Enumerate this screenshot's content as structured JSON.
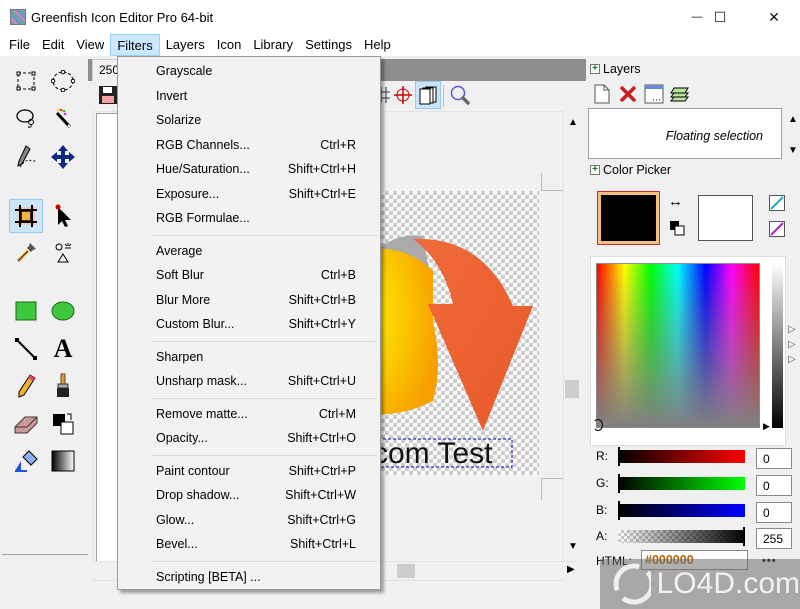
{
  "window": {
    "title": "Greenfish Icon Editor Pro 64-bit",
    "minimize_glyph": "—",
    "maximize_glyph": "☐",
    "close_glyph": "✕"
  },
  "menubar": {
    "items": [
      {
        "label": "File"
      },
      {
        "label": "Edit"
      },
      {
        "label": "View"
      },
      {
        "label": "Filters",
        "active": true
      },
      {
        "label": "Layers"
      },
      {
        "label": "Icon"
      },
      {
        "label": "Library"
      },
      {
        "label": "Settings"
      },
      {
        "label": "Help"
      }
    ]
  },
  "toolbox": {
    "tools": [
      {
        "name": "rect-select-icon"
      },
      {
        "name": "ellipse-select-icon"
      },
      {
        "name": "lasso-icon"
      },
      {
        "name": "magic-wand-icon"
      },
      {
        "name": "freehand-select-icon"
      },
      {
        "name": "move-icon"
      },
      {
        "name": "crop-icon",
        "selected": true
      },
      {
        "name": "pointer-icon"
      },
      {
        "name": "eyedropper-icon"
      },
      {
        "name": "fill-icon"
      },
      {
        "name": "rectangle-icon"
      },
      {
        "name": "ellipse-icon"
      },
      {
        "name": "line-icon"
      },
      {
        "name": "text-icon",
        "glyph": "A"
      },
      {
        "name": "pencil-icon"
      },
      {
        "name": "brush-icon"
      },
      {
        "name": "eraser-icon"
      },
      {
        "name": "color-replace-icon"
      },
      {
        "name": "gradient-fill-icon"
      },
      {
        "name": "gradient-icon"
      }
    ]
  },
  "document": {
    "tab_label": "250",
    "canvas_text": "com Test"
  },
  "filters_menu": {
    "groups": [
      [
        {
          "label": "Grayscale",
          "shortcut": ""
        },
        {
          "label": "Invert",
          "shortcut": ""
        },
        {
          "label": "Solarize",
          "shortcut": ""
        },
        {
          "label": "RGB Channels...",
          "shortcut": "Ctrl+R"
        },
        {
          "label": "Hue/Saturation...",
          "shortcut": "Shift+Ctrl+H"
        },
        {
          "label": "Exposure...",
          "shortcut": "Shift+Ctrl+E"
        },
        {
          "label": "RGB Formulae...",
          "shortcut": ""
        }
      ],
      [
        {
          "label": "Average",
          "shortcut": ""
        },
        {
          "label": "Soft Blur",
          "shortcut": "Ctrl+B"
        },
        {
          "label": "Blur More",
          "shortcut": "Shift+Ctrl+B"
        },
        {
          "label": "Custom Blur...",
          "shortcut": "Shift+Ctrl+Y"
        }
      ],
      [
        {
          "label": "Sharpen",
          "shortcut": ""
        },
        {
          "label": "Unsharp mask...",
          "shortcut": "Shift+Ctrl+U"
        }
      ],
      [
        {
          "label": "Remove matte...",
          "shortcut": "Ctrl+M"
        },
        {
          "label": "Opacity...",
          "shortcut": "Shift+Ctrl+O"
        }
      ],
      [
        {
          "label": "Paint contour",
          "shortcut": "Shift+Ctrl+P"
        },
        {
          "label": "Drop shadow...",
          "shortcut": "Shift+Ctrl+W"
        },
        {
          "label": "Glow...",
          "shortcut": "Shift+Ctrl+G"
        },
        {
          "label": "Bevel...",
          "shortcut": "Shift+Ctrl+L"
        }
      ],
      [
        {
          "label": "Scripting [BETA] ...",
          "shortcut": ""
        }
      ]
    ]
  },
  "layers_panel": {
    "title": "Layers",
    "expand_glyph": "+",
    "layer_name": "Floating selection"
  },
  "color_picker": {
    "title": "Color Picker",
    "expand_glyph": "+",
    "primary_color": "#000000",
    "secondary_color": "#ffffff",
    "swap_glyph": "↔",
    "channels": [
      {
        "label": "R:",
        "value": "0",
        "fraction": 0,
        "gradient_to": "#ff0000"
      },
      {
        "label": "G:",
        "value": "0",
        "fraction": 0,
        "gradient_to": "#00ff00"
      },
      {
        "label": "B:",
        "value": "0",
        "fraction": 0,
        "gradient_to": "#0000ff"
      },
      {
        "label": "A:",
        "value": "255",
        "fraction": 1,
        "gradient_to": "#000000"
      }
    ],
    "html_label": "HTML:",
    "html_value": "#000000",
    "more_glyph": "•••"
  },
  "watermark": {
    "text": "LO4D.com"
  }
}
